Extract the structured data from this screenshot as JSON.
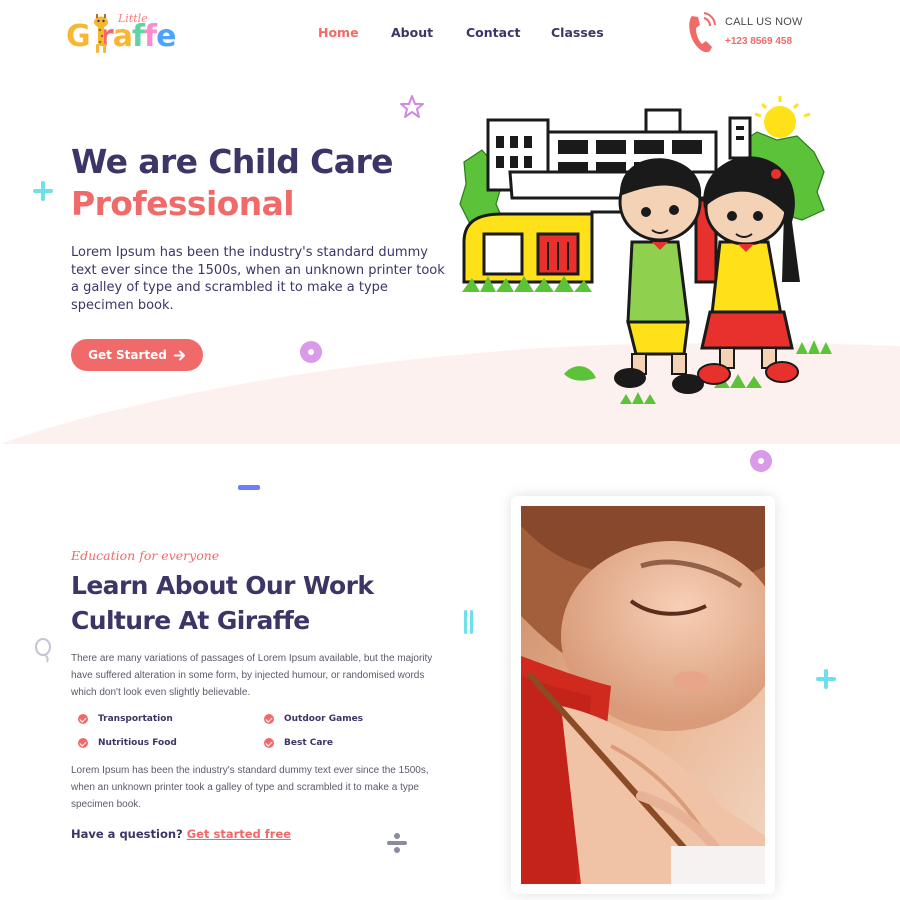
{
  "colors": {
    "primary_text": "#3d3566",
    "accent": "#f06a6a",
    "hero_bg": "#fdf1ef",
    "deco_cyan": "#6fe0e8",
    "deco_purple": "#d08ae6",
    "deco_blue": "#6b7fff"
  },
  "header": {
    "logo": {
      "small_word": "Little",
      "letters": [
        "G",
        "i",
        "r",
        "a",
        "f",
        "f",
        "e"
      ],
      "icon": "giraffe-icon"
    },
    "nav": [
      {
        "label": "Home",
        "active": true
      },
      {
        "label": "About",
        "active": false
      },
      {
        "label": "Contact",
        "active": false
      },
      {
        "label": "Classes",
        "active": false
      }
    ],
    "call": {
      "label": "CALL US NOW",
      "number": "+123 8569 458",
      "icon": "phone-icon"
    }
  },
  "hero": {
    "title_line1": "We are Child Care",
    "title_line2": "Professional",
    "text": "Lorem Ipsum has been the industry's standard dummy text ever since the 1500s, when an unknown printer took a galley of type and scrambled it to make a type specimen book.",
    "button_label": "Get Started",
    "button_icon": "arrow-right-icon"
  },
  "about": {
    "kicker": "Education for everyone",
    "title": "Learn About Our Work Culture At Giraffe",
    "paragraph1": "There are many variations of passages of Lorem Ipsum available, but the majority have suffered alteration in some form, by injected humour, or randomised words which don't look even slightly believable.",
    "features": [
      "Transportation",
      "Outdoor Games",
      "Nutritious Food",
      "Best Care"
    ],
    "paragraph2": "Lorem Ipsum has been the industry's standard dummy text ever since the 1500s, when an unknown printer took a galley of type and scrambled it to make a type specimen book.",
    "question_text": "Have a question?",
    "question_link": "Get started free"
  }
}
